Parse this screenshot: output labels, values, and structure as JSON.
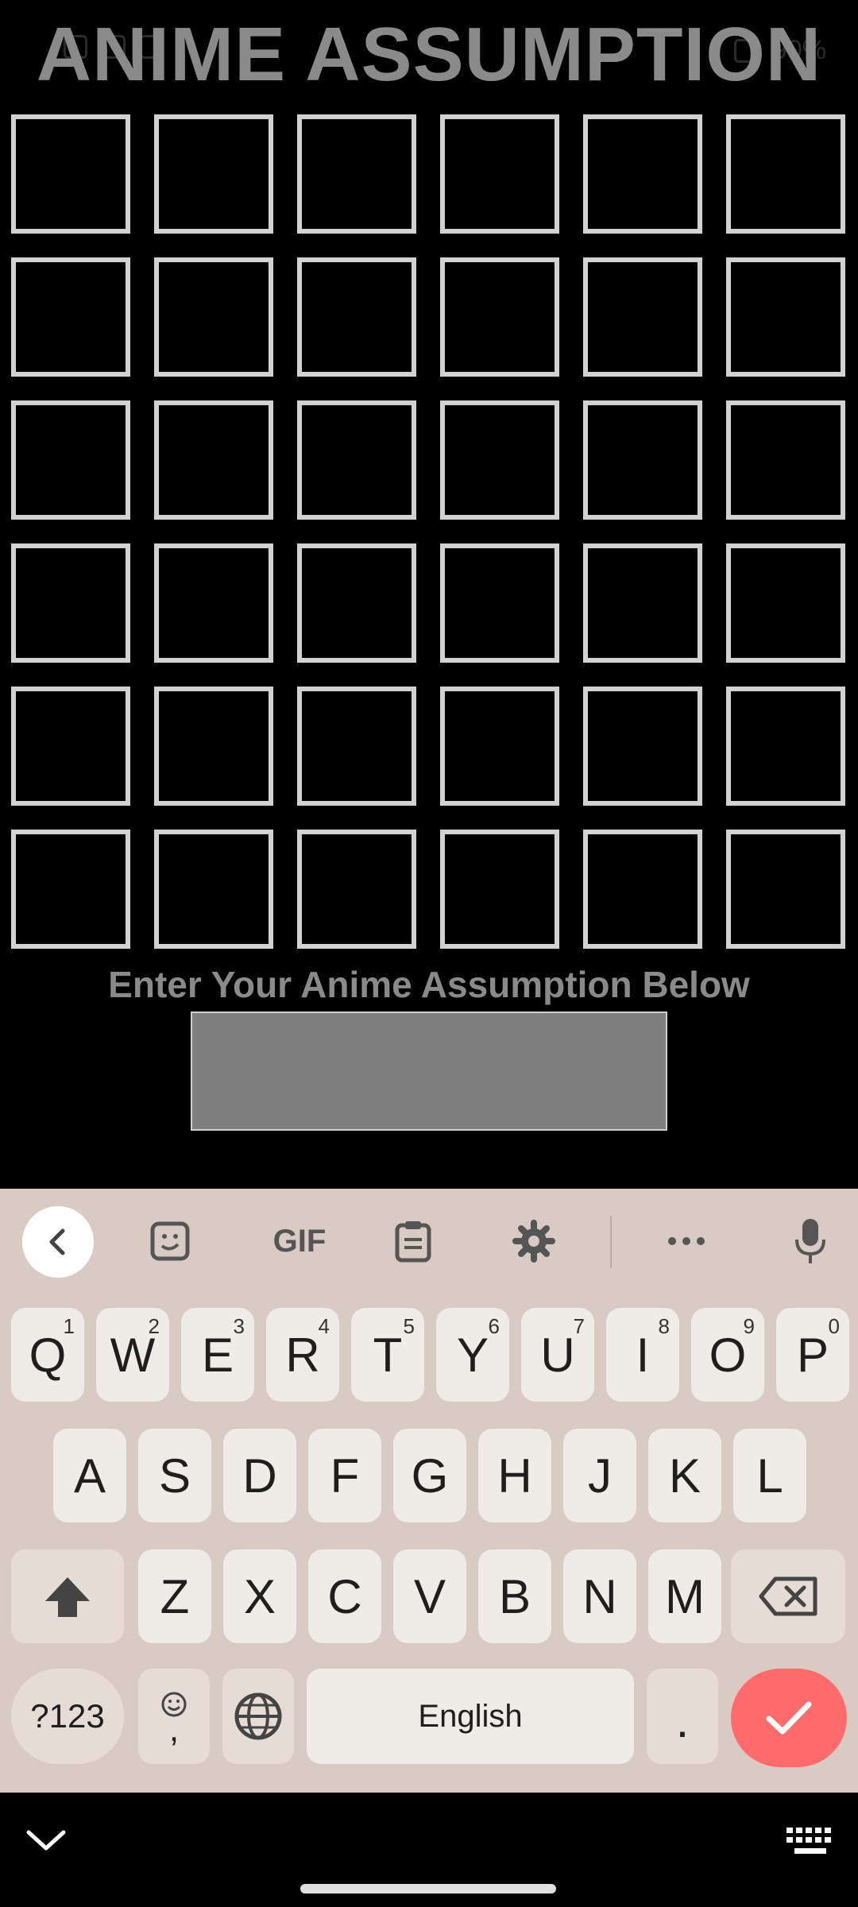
{
  "status_bar": {
    "battery": "90%"
  },
  "title": "ANIME ASSUMPTION",
  "grid": {
    "rows": 6,
    "cols": 6
  },
  "prompt": "Enter Your Anime Assumption Below",
  "answer_input": {
    "value": "",
    "placeholder": ""
  },
  "keyboard": {
    "toolbar": {
      "back_icon": "chevron-left-icon",
      "sticker_icon": "sticker-icon",
      "gif_label": "GIF",
      "clipboard_icon": "clipboard-icon",
      "settings_icon": "gear-icon",
      "more_icon": "ellipsis-icon",
      "mic_icon": "microphone-icon"
    },
    "row1": [
      {
        "key": "Q",
        "hint": "1"
      },
      {
        "key": "W",
        "hint": "2"
      },
      {
        "key": "E",
        "hint": "3"
      },
      {
        "key": "R",
        "hint": "4"
      },
      {
        "key": "T",
        "hint": "5"
      },
      {
        "key": "Y",
        "hint": "6"
      },
      {
        "key": "U",
        "hint": "7"
      },
      {
        "key": "I",
        "hint": "8"
      },
      {
        "key": "O",
        "hint": "9"
      },
      {
        "key": "P",
        "hint": "0"
      }
    ],
    "row2": [
      "A",
      "S",
      "D",
      "F",
      "G",
      "H",
      "J",
      "K",
      "L"
    ],
    "row3": [
      "Z",
      "X",
      "C",
      "V",
      "B",
      "N",
      "M"
    ],
    "symbols_label": "?123",
    "comma_label": ",",
    "space_label": "English",
    "period_label": ".",
    "shift_icon": "shift-arrow-icon",
    "backspace_icon": "backspace-icon",
    "globe_icon": "globe-icon",
    "emoji_icon": "emoji-icon",
    "enter_icon": "check-icon",
    "accent_color": "#fd6b6c",
    "background_color": "#d9cbc3"
  },
  "nav_bar": {
    "hide_keyboard_icon": "chevron-down-icon",
    "switch_keyboard_icon": "keyboard-icon"
  }
}
